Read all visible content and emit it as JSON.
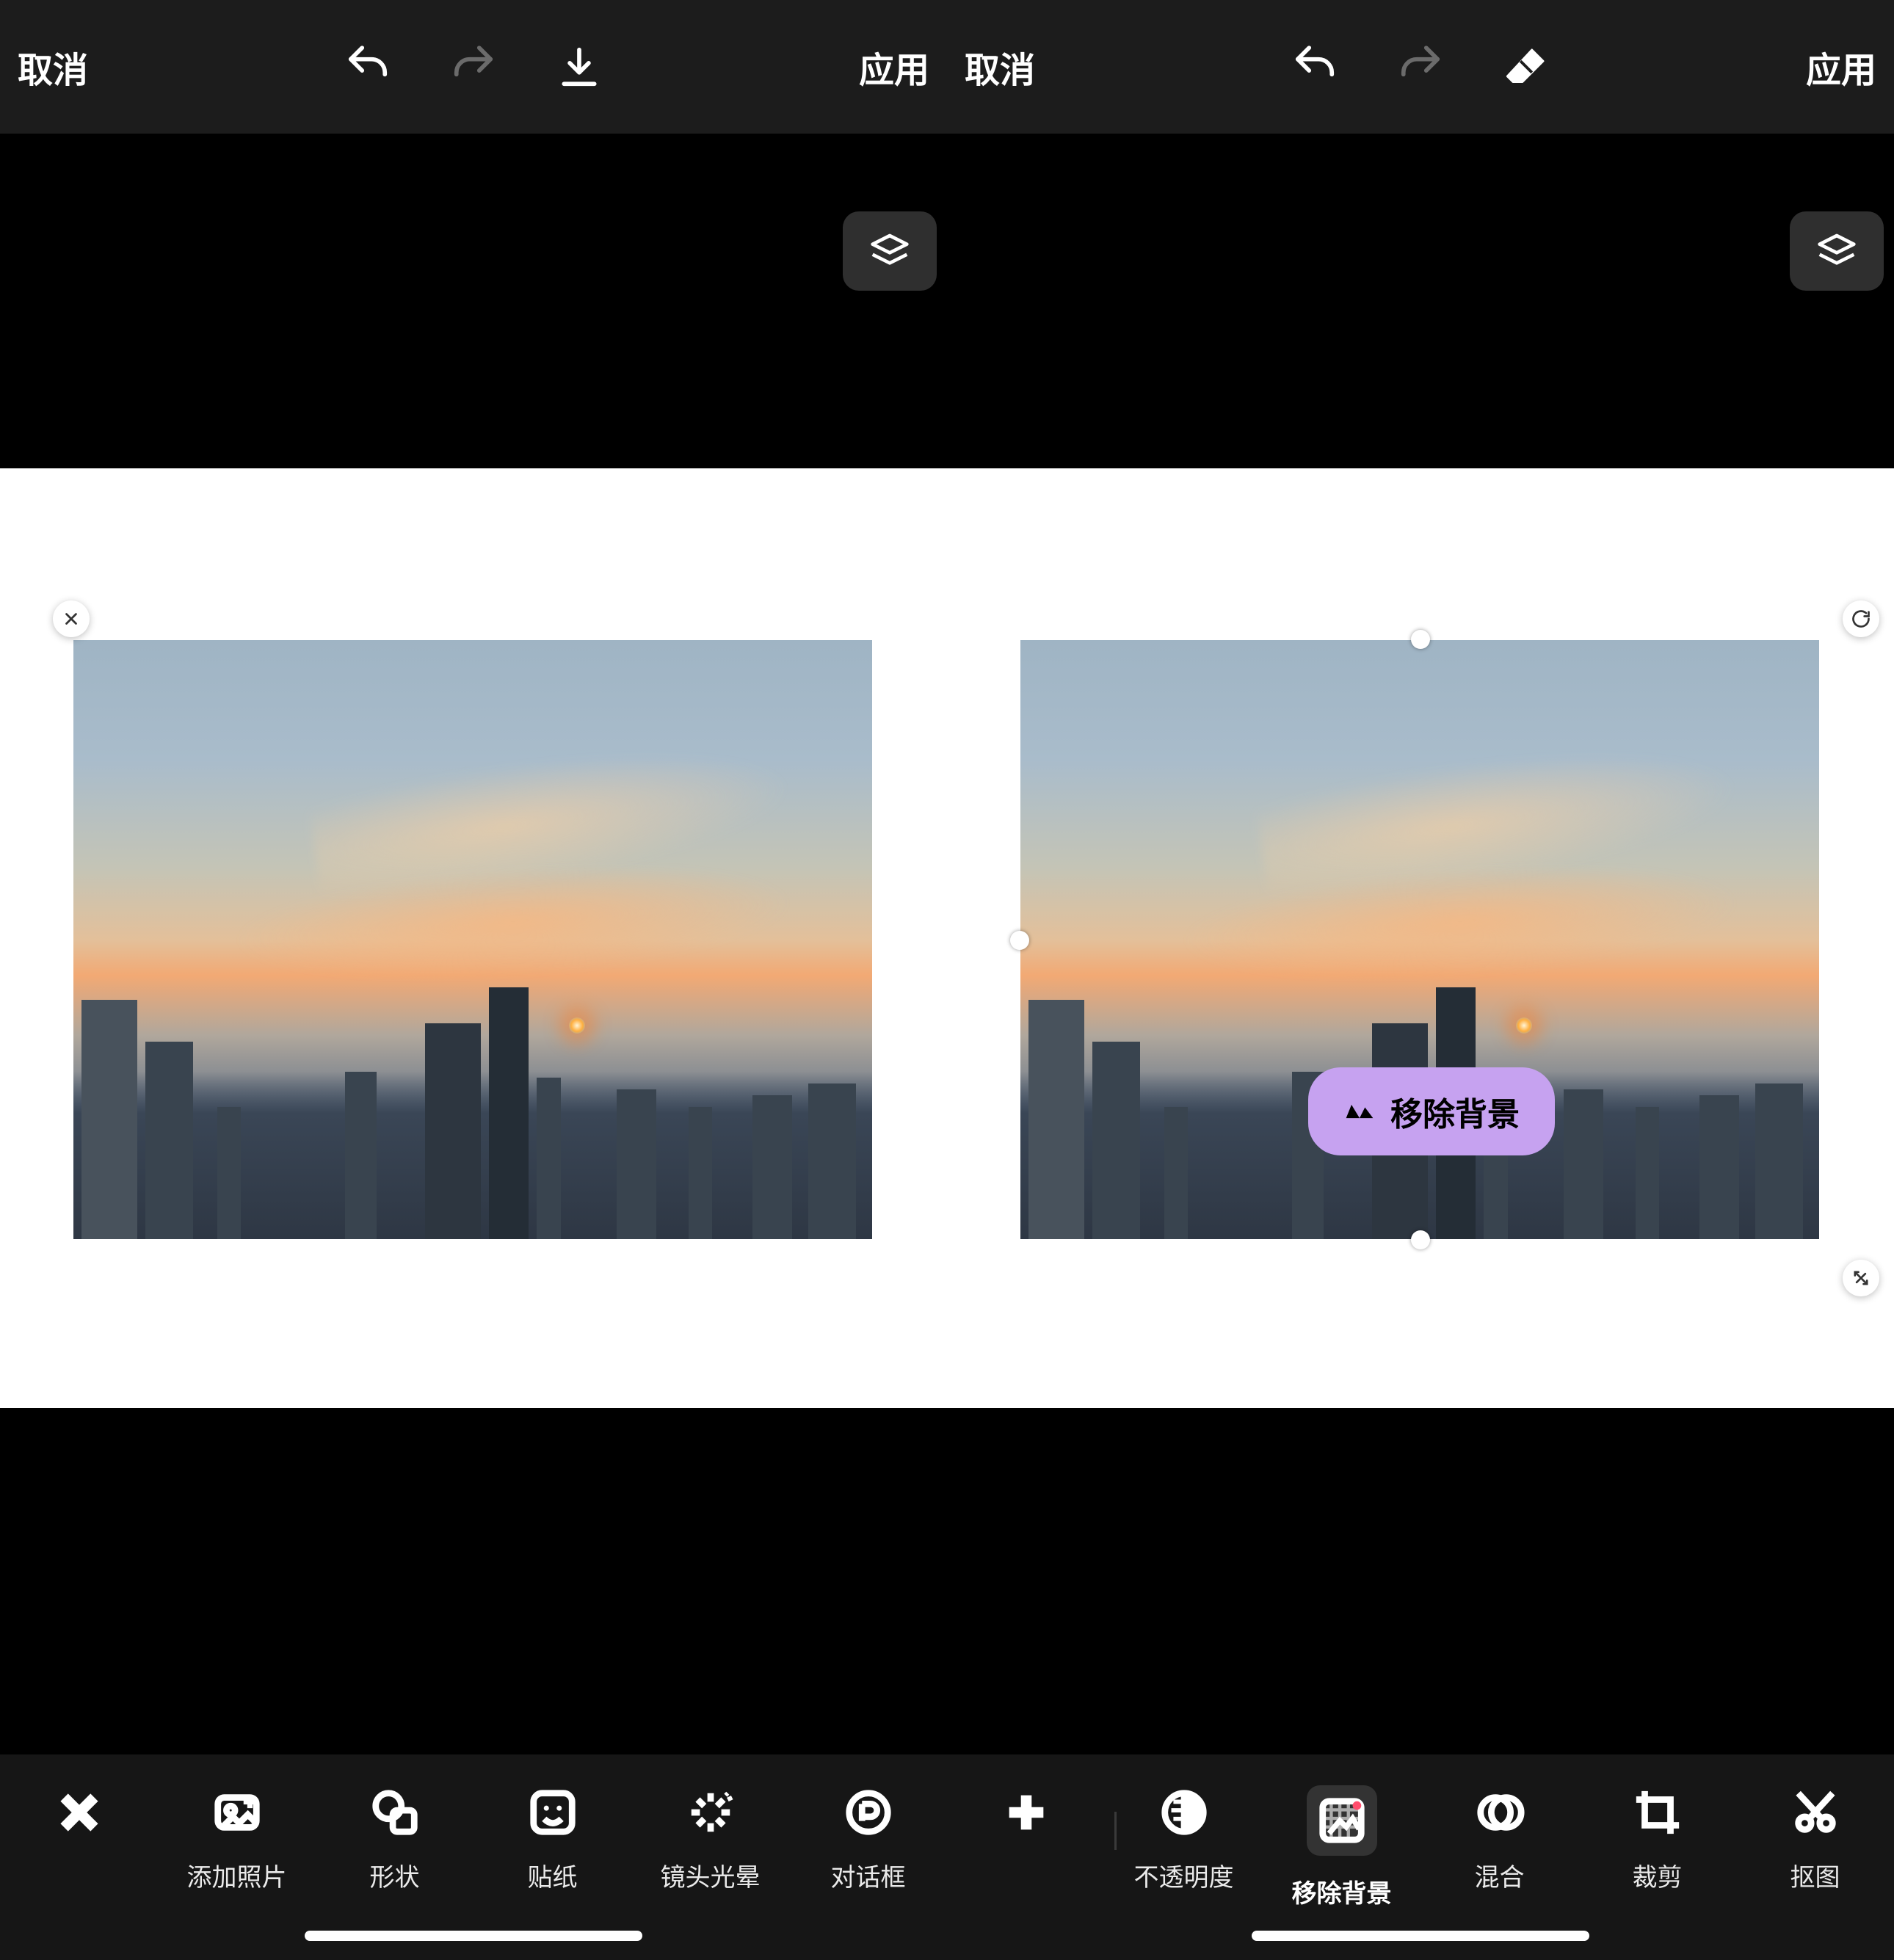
{
  "topbar": {
    "cancel": "取消",
    "apply": "应用"
  },
  "pill": {
    "remove_bg": "移除背景"
  },
  "left_tools": [
    {
      "id": "close",
      "label": ""
    },
    {
      "id": "add-photo",
      "label": "添加照片"
    },
    {
      "id": "shape",
      "label": "形状"
    },
    {
      "id": "sticker",
      "label": "贴纸"
    },
    {
      "id": "lens-flare",
      "label": "镜头光晕"
    },
    {
      "id": "speech-bubble",
      "label": "对话框"
    }
  ],
  "right_tools": [
    {
      "id": "add",
      "label": ""
    },
    {
      "id": "opacity",
      "label": "不透明度"
    },
    {
      "id": "remove-bg",
      "label": "移除背景"
    },
    {
      "id": "blend",
      "label": "混合"
    },
    {
      "id": "crop",
      "label": "裁剪"
    },
    {
      "id": "cutout",
      "label": "抠图"
    }
  ]
}
